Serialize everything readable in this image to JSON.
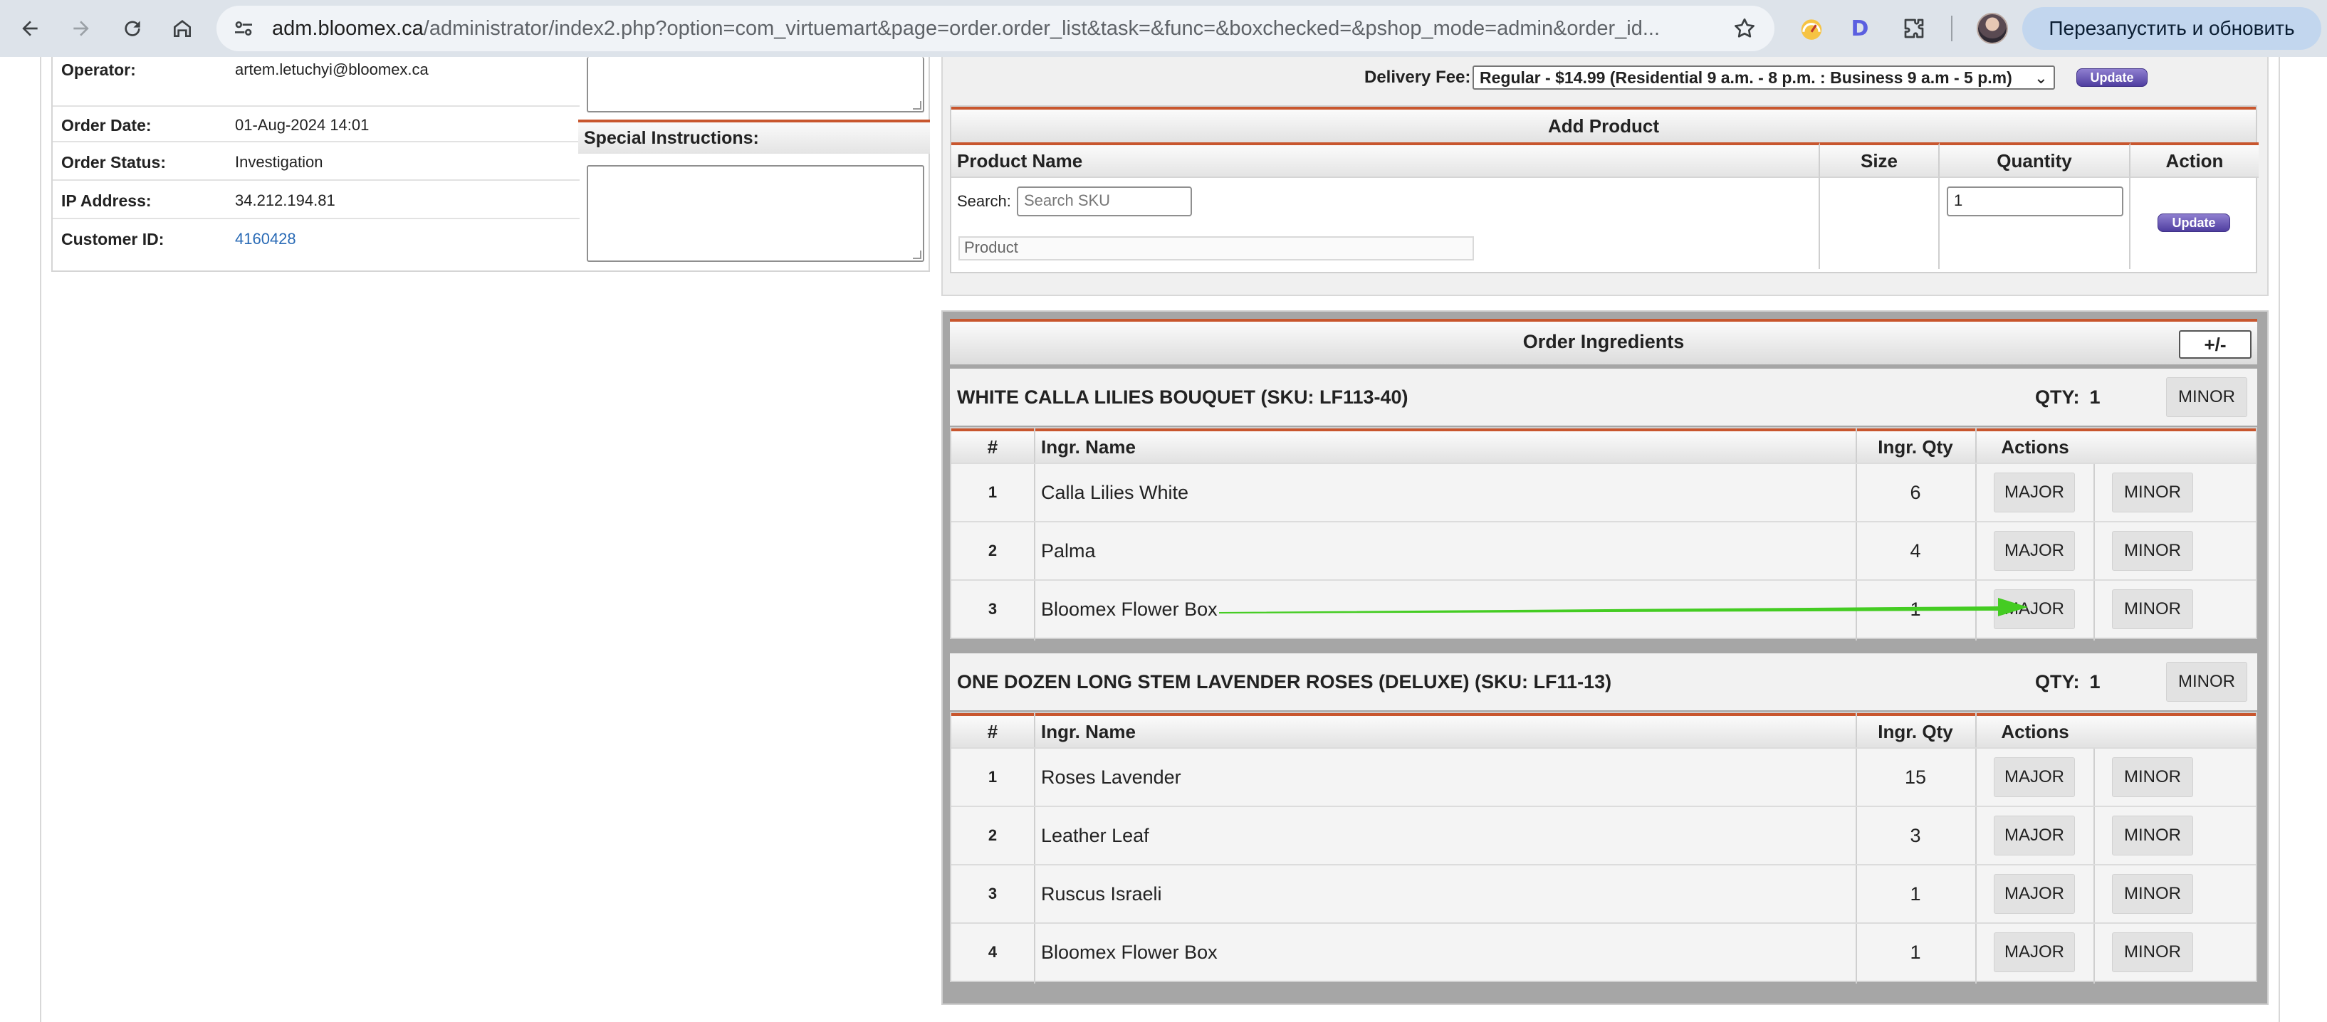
{
  "browser": {
    "url_host": "adm.bloomex.ca",
    "url_path": "/administrator/index2.php?option=com_virtuemart&page=order.order_list&task=&func=&boxchecked=&pshop_mode=admin&order_id...",
    "relaunch_label": "Перезапустить и обновить",
    "extension_letter": "D"
  },
  "order_info": {
    "operator_label": "Operator:",
    "operator_value": "artem.letuchyi@bloomex.ca",
    "order_date_label": "Order Date:",
    "order_date_value": "01-Aug-2024 14:01",
    "order_status_label": "Order Status:",
    "order_status_value": "Investigation",
    "ip_label": "IP Address:",
    "ip_value": "34.212.194.81",
    "customer_id_label": "Customer ID:",
    "customer_id_value": "4160428",
    "special_instructions_label": "Special Instructions:"
  },
  "delivery": {
    "label": "Delivery Fee:",
    "selected": "Regular - $14.99 (Residential 9 a.m. - 8 p.m. : Business 9 a.m - 5 p.m)",
    "update_label": "Update"
  },
  "add_product": {
    "title": "Add Product",
    "headers": [
      "Product Name",
      "Size",
      "Quantity",
      "Action"
    ],
    "search_label": "Search:",
    "search_placeholder": "Search SKU",
    "product_placeholder": "Product",
    "quantity_value": "1",
    "update_label": "Update"
  },
  "ingredients": {
    "title": "Order Ingredients",
    "toggle_label": "+/-",
    "headers": [
      "#",
      "Ingr. Name",
      "Ingr. Qty",
      "Actions"
    ],
    "qty_label": "QTY:",
    "major_label": "MAJOR",
    "minor_label": "MINOR",
    "bouquets": [
      {
        "name": "WHITE CALLA LILIES BOUQUET (SKU: LF113-40)",
        "qty": "1",
        "items": [
          {
            "num": "1",
            "name": "Calla Lilies White",
            "qty": "6"
          },
          {
            "num": "2",
            "name": "Palma",
            "qty": "4"
          },
          {
            "num": "3",
            "name": "Bloomex Flower Box",
            "qty": "1"
          }
        ]
      },
      {
        "name": "ONE DOZEN LONG STEM LAVENDER ROSES (DELUXE) (SKU: LF11-13)",
        "qty": "1",
        "items": [
          {
            "num": "1",
            "name": "Roses Lavender",
            "qty": "15"
          },
          {
            "num": "2",
            "name": "Leather Leaf",
            "qty": "3"
          },
          {
            "num": "3",
            "name": "Ruscus Israeli",
            "qty": "1"
          },
          {
            "num": "4",
            "name": "Bloomex Flower Box",
            "qty": "1"
          }
        ]
      }
    ]
  },
  "colors": {
    "accent_rule": "#c8562e",
    "update_button": "#5b4aa8",
    "annotation_arrow": "#44cc22",
    "link": "#2a6bb6"
  }
}
